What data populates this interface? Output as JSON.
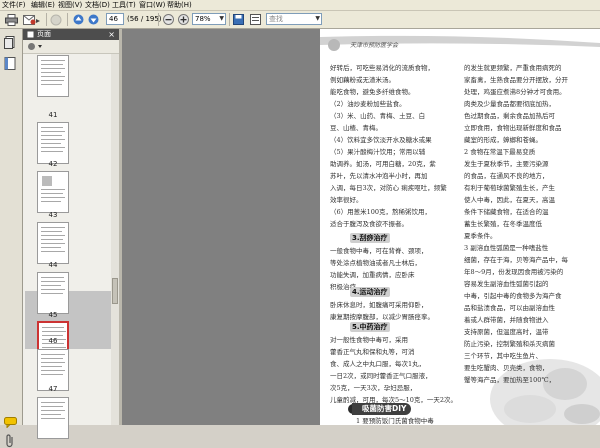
{
  "menubar": {
    "items": [
      {
        "label": "文件(F)"
      },
      {
        "label": "编辑(E)"
      },
      {
        "label": "视图(V)"
      },
      {
        "label": "文档(D)"
      },
      {
        "label": "工具(T)"
      },
      {
        "label": "窗口(W)"
      },
      {
        "label": "帮助(H)"
      }
    ]
  },
  "toolbar": {
    "page_input": "46",
    "page_total": "(56 / 195)",
    "zoom_value": "78%",
    "search_placeholder": "查找",
    "icons": [
      "print-icon",
      "email-icon",
      "hand-tool-icon",
      "prev-page-icon",
      "next-page-icon",
      "zoom-out-icon",
      "zoom-in-icon",
      "save-icon",
      "read-mode-icon"
    ]
  },
  "panel": {
    "title": "页面",
    "close_glyph": "×",
    "thumbnails": [
      {
        "label": "41"
      },
      {
        "label": "42"
      },
      {
        "label": "43"
      },
      {
        "label": "44"
      },
      {
        "label": "45"
      },
      {
        "label": "46",
        "selected": true
      },
      {
        "label": "47"
      },
      {
        "label": ""
      }
    ]
  },
  "page": {
    "header_title": "天津市预防医学会",
    "left_col": [
      "好转后，可吃些易消化的流质食物，",
      "例如藕粉或无渣米汤。",
      "能吃食物，避免多纤维食物。",
      "（2）油炒麦粉加些盐食。",
      "（3）米、山药、青梅、土豆、白",
      "豆、山楂、青梅。",
      "（4）饮料宜多饮淡开水及糖水或果",
      "（5）果汁酸梅汁饮用；常用以辅",
      "助调养。如汤，可用白糖，20克，紫",
      "苏叶，先以清水冲泡半小时，再加",
      "入调，每日3次，对防心 痢疾呕吐，频繁",
      "效率很好。",
      "（6）用葱米100克，熬稀粥饮用，",
      "适合于腹泻及食欲不振者。"
    ],
    "heading_1": "3.刮痧治疗",
    "left_col_2": [
      "一般食物中毒，可在背脊、颈项，",
      "等处涂点植物油或者凡士林后，",
      "功能失调，加重病情，应卧床",
      "积极治疗。"
    ],
    "heading_2": "4.运动治疗",
    "left_col_3": [
      "卧床休息时，如腹痛可采用仰卧，",
      "康复期按摩腹部，以减少胃肠痉挛。"
    ],
    "heading_3": "5.中药治疗",
    "left_col_4": [
      "对一般性食物中毒可，采用",
      "藿香正气丸和保和丸等，可消",
      "食、成人之中丸口服，每次1丸，",
      "一日2次，或同时藿香正气口服液，",
      "次5克，一天3次，孕妇忌服，",
      "儿童酌减，可用，每次5～10克，一天2次。"
    ],
    "right_col": [
      "的发生就更频繁，严重食用病死的",
      "家畜禽，生熟食品要分开摆放，分开",
      "处理，鸡蛋应煮沸8分钟才可食用。",
      "肉类及少量食品都要彻底加热，",
      "色过期食品，剩余食品加热后可",
      "立即食用，食物出现新鲜度和食品",
      "藏室的形成，蟑螂和苍蝇。",
      "2 食物在常温下最易变质",
      "发生于夏秋季节，主要污染源",
      "的食品，在通风不良的地方，",
      "有利于葡萄球菌繁殖生长，产生",
      "使人中毒，因此，在夏天，高温",
      "条件下储藏食物，在适合的温",
      "蓄生长繁殖，在冬季温度低",
      "夏季条件。",
      "3 副溶血性弧菌是一种嗜盐性",
      "细菌，存在于海，贝等海产品中，每",
      "年8～9月，份发现因食用被污染的",
      "容易发生副溶血性弧菌引起的",
      "中毒，引起中毒的食物多为海产食",
      "品和盐渍食品，可以由副溶血性",
      "着或人群带菌，并随食物进入",
      "支持原菌，但温度高时，温带",
      "防止污染，控制繁殖和杀灭病菌",
      "三个环节，其中吃生鱼片、",
      "要生吃蟹肉、贝壳类，食物，",
      "蟹等海产品，要加热至100℃，"
    ],
    "diy_heading": "吸菌防害DIY",
    "last_line": "1 要预防饭门氏菌食物中毒"
  },
  "colors": {
    "chrome": "#ece9d8",
    "panel_head": "#4d4d4d",
    "viewer_bg": "#808080",
    "heading_bg": "#cfcfcf",
    "diy_bg": "#3f3f3f"
  }
}
